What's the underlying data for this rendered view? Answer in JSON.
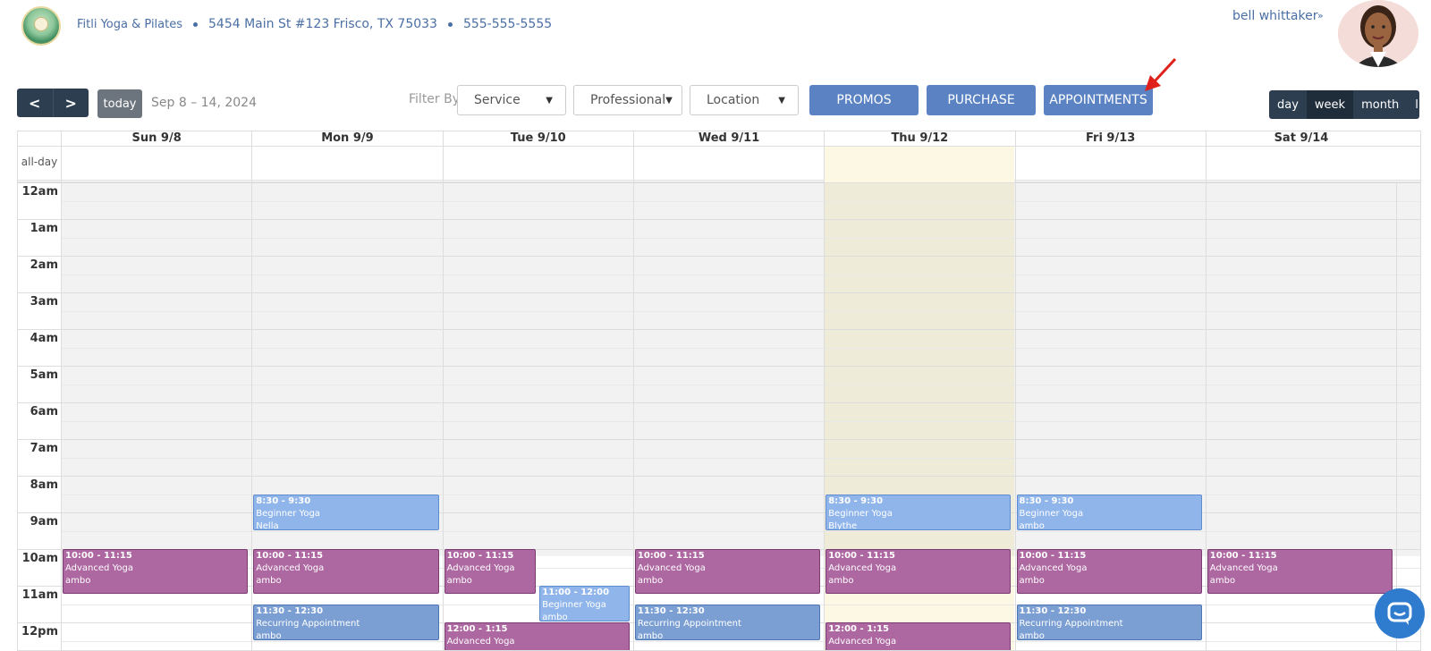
{
  "header": {
    "business_name": "Fitli Yoga & Pilates",
    "address": "5454 Main St #123 Frisco, TX 75033",
    "phone": "555-555-5555",
    "user_name": "bell whittaker"
  },
  "toolbar": {
    "prev_icon": "<",
    "next_icon": ">",
    "today_label": "today",
    "date_range": "Sep 8 – 14, 2024",
    "filter_label": "Filter By",
    "filters": {
      "service": "Service",
      "professional": "Professional",
      "location": "Location"
    },
    "promos_label": "PROMOS",
    "purchase_label": "PURCHASE",
    "appointments_label": "APPOINTMENTS",
    "views": {
      "day": "day",
      "week": "week",
      "month": "month",
      "list": "list",
      "active": "week"
    }
  },
  "calendar": {
    "days": [
      "Sun 9/8",
      "Mon 9/9",
      "Tue 9/10",
      "Wed 9/11",
      "Thu 9/12",
      "Fri 9/13",
      "Sat 9/14"
    ],
    "today_index": 4,
    "all_day_label": "all-day",
    "hours": [
      "12am",
      "1am",
      "2am",
      "3am",
      "4am",
      "5am",
      "6am",
      "7am",
      "8am",
      "9am",
      "10am",
      "11am",
      "12pm"
    ],
    "events": [
      {
        "day": 1,
        "time": "8:30 - 9:30",
        "title": "Beginner Yoga",
        "who": "Nella",
        "style": "blue"
      },
      {
        "day": 4,
        "time": "8:30 - 9:30",
        "title": "Beginner Yoga",
        "who": "Blythe",
        "style": "blue"
      },
      {
        "day": 5,
        "time": "8:30 - 9:30",
        "title": "Beginner Yoga",
        "who": "ambo",
        "style": "blue"
      },
      {
        "day": 0,
        "time": "10:00 - 11:15",
        "title": "Advanced Yoga",
        "who": "ambo",
        "style": "purple"
      },
      {
        "day": 1,
        "time": "10:00 - 11:15",
        "title": "Advanced Yoga",
        "who": "ambo",
        "style": "purple"
      },
      {
        "day": 2,
        "time": "10:00 - 11:15",
        "title": "Advanced Yoga",
        "who": "ambo",
        "style": "purple"
      },
      {
        "day": 3,
        "time": "10:00 - 11:15",
        "title": "Advanced Yoga",
        "who": "ambo",
        "style": "purple"
      },
      {
        "day": 4,
        "time": "10:00 - 11:15",
        "title": "Advanced Yoga",
        "who": "ambo",
        "style": "purple"
      },
      {
        "day": 5,
        "time": "10:00 - 11:15",
        "title": "Advanced Yoga",
        "who": "ambo",
        "style": "purple"
      },
      {
        "day": 6,
        "time": "10:00 - 11:15",
        "title": "Advanced Yoga",
        "who": "ambo",
        "style": "purple"
      },
      {
        "day": 2,
        "time": "11:00 - 12:00",
        "title": "Beginner Yoga",
        "who": "ambo",
        "style": "blue"
      },
      {
        "day": 1,
        "time": "11:30 - 12:30",
        "title": "Recurring Appointment",
        "who": "ambo",
        "style": "mid"
      },
      {
        "day": 3,
        "time": "11:30 - 12:30",
        "title": "Recurring Appointment",
        "who": "ambo",
        "style": "mid"
      },
      {
        "day": 5,
        "time": "11:30 - 12:30",
        "title": "Recurring Appointment",
        "who": "ambo",
        "style": "mid"
      },
      {
        "day": 2,
        "time": "12:00 - 1:15",
        "title": "Advanced Yoga",
        "who": "",
        "style": "purple"
      },
      {
        "day": 4,
        "time": "12:00 - 1:15",
        "title": "Advanced Yoga",
        "who": "",
        "style": "purple"
      }
    ]
  },
  "colors": {
    "primary_button": "#5b83c4",
    "dark_nav": "#2c3e50",
    "today_bg": "#fcf8e3",
    "purple_event": "#ad67a1",
    "blue_event": "#90b5ea"
  },
  "icons": {
    "chat": "chat-bubble-icon",
    "arrow": "red-arrow-icon",
    "user_menu": "chevron-double-down-icon"
  }
}
